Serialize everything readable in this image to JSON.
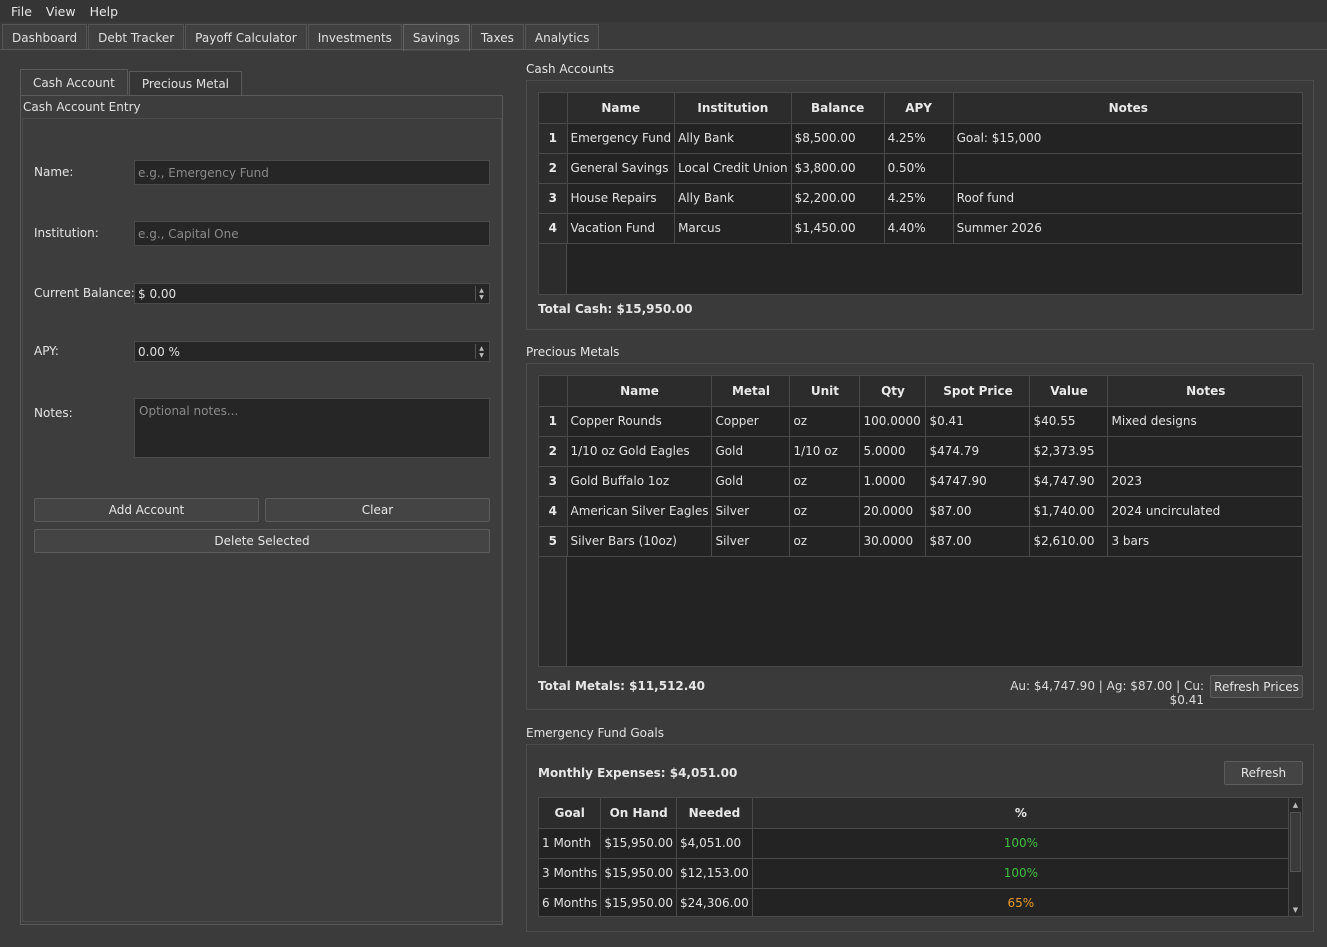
{
  "menu": [
    "File",
    "View",
    "Help"
  ],
  "main_tabs": [
    "Dashboard",
    "Debt Tracker",
    "Payoff Calculator",
    "Investments",
    "Savings",
    "Taxes",
    "Analytics"
  ],
  "active_tab": "Savings",
  "sub_tabs": [
    "Cash Account",
    "Precious Metal"
  ],
  "form": {
    "group_title": "Cash Account Entry",
    "name_label": "Name:",
    "name_placeholder": "e.g., Emergency Fund",
    "institution_label": "Institution:",
    "institution_placeholder": "e.g., Capital One",
    "balance_label": "Current Balance:",
    "balance_value": "$ 0.00",
    "apy_label": "APY:",
    "apy_value": "0.00 %",
    "notes_label": "Notes:",
    "notes_placeholder": "Optional notes...",
    "add_button": "Add Account",
    "clear_button": "Clear",
    "delete_button": "Delete Selected"
  },
  "cash": {
    "title": "Cash Accounts",
    "headers": [
      "Name",
      "Institution",
      "Balance",
      "APY",
      "Notes"
    ],
    "rows": [
      {
        "n": "1",
        "cells": [
          "Emergency Fund",
          "Ally Bank",
          "$8,500.00",
          "4.25%",
          "Goal: $15,000"
        ]
      },
      {
        "n": "2",
        "cells": [
          "General Savings",
          "Local Credit Union",
          "$3,800.00",
          "0.50%",
          ""
        ]
      },
      {
        "n": "3",
        "cells": [
          "House Repairs",
          "Ally Bank",
          "$2,200.00",
          "4.25%",
          "Roof fund"
        ]
      },
      {
        "n": "4",
        "cells": [
          "Vacation Fund",
          "Marcus",
          "$1,450.00",
          "4.40%",
          "Summer 2026"
        ]
      }
    ],
    "total": "Total Cash: $15,950.00"
  },
  "metals": {
    "title": "Precious Metals",
    "headers": [
      "Name",
      "Metal",
      "Unit",
      "Qty",
      "Spot Price",
      "Value",
      "Notes"
    ],
    "rows": [
      {
        "n": "1",
        "cells": [
          "Copper Rounds",
          "Copper",
          "oz",
          "100.0000",
          "$0.41",
          "$40.55",
          "Mixed designs"
        ]
      },
      {
        "n": "2",
        "cells": [
          "1/10 oz Gold Eagles",
          "Gold",
          "1/10 oz",
          "5.0000",
          "$474.79",
          "$2,373.95",
          ""
        ]
      },
      {
        "n": "3",
        "cells": [
          "Gold Buffalo 1oz",
          "Gold",
          "oz",
          "1.0000",
          "$4747.90",
          "$4,747.90",
          "2023"
        ]
      },
      {
        "n": "4",
        "cells": [
          "American Silver Eagles",
          "Silver",
          "oz",
          "20.0000",
          "$87.00",
          "$1,740.00",
          "2024 uncirculated"
        ]
      },
      {
        "n": "5",
        "cells": [
          "Silver Bars (10oz)",
          "Silver",
          "oz",
          "30.0000",
          "$87.00",
          "$2,610.00",
          "3 bars"
        ]
      }
    ],
    "total": "Total Metals: $11,512.40",
    "spot_summary": "Au: $4,747.90 | Ag: $87.00 | Cu: $0.41",
    "refresh_prices_button": "Refresh Prices"
  },
  "goals": {
    "title": "Emergency Fund Goals",
    "monthly_expenses": "Monthly Expenses: $4,051.00",
    "refresh_button": "Refresh",
    "headers": [
      "Goal",
      "On Hand",
      "Needed",
      "%"
    ],
    "rows": [
      {
        "cells": [
          "1 Month",
          "$15,950.00",
          "$4,051.00",
          "100%"
        ],
        "color": "#3fbf3f"
      },
      {
        "cells": [
          "3 Months",
          "$15,950.00",
          "$12,153.00",
          "100%"
        ],
        "color": "#3fbf3f"
      },
      {
        "cells": [
          "6 Months",
          "$15,950.00",
          "$24,306.00",
          "65%"
        ],
        "color": "#e59a2e"
      }
    ]
  }
}
